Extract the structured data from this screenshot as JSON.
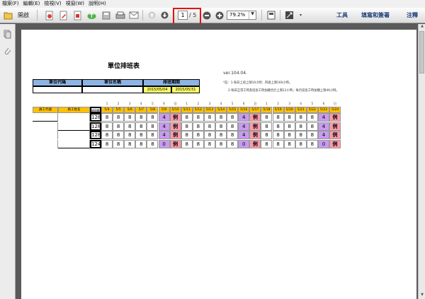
{
  "menu": [
    "檔案(F)",
    "編輯(E)",
    "檢視(V)",
    "視窗(W)",
    "說明(H)"
  ],
  "toolbar": {
    "open_label": "開啟",
    "page_current": "1",
    "page_total": "/ 5",
    "zoom": "79.2%",
    "tools_label": "工具",
    "fill_sign_label": "填寫和簽署",
    "comment_label": "注釋"
  },
  "document": {
    "title": "單位排班表",
    "version": "ver.104.04.",
    "note1": "*註：1.每日上班上限10小時；四週上限160小時。",
    "note2": "2.每日正常工時及延長工時加總合計上限12小時；每月延長工時加總上限46小時。",
    "header_table": {
      "unit_code_label": "單位代碼",
      "unit_name_label": "單位名稱",
      "period_label": "排班期間",
      "period_start": "2015/05/04",
      "period_end": "2015/05/31"
    },
    "schedule": {
      "emp_id_label": "員工代號",
      "emp_name_label": "員工姓名",
      "total_label": "總時數",
      "weekdays": [
        "1",
        "2",
        "3",
        "4",
        "5",
        "6",
        "日",
        "1",
        "2",
        "3",
        "4",
        "5",
        "6",
        "日",
        "1",
        "2",
        "3",
        "4",
        "5",
        "6",
        "日"
      ],
      "dates": [
        "5/4",
        "5/5",
        "5/6",
        "5/7",
        "5/8",
        "5/9",
        "5/10",
        "5/11",
        "5/12",
        "5/13",
        "5/14",
        "5/15",
        "5/16",
        "5/17",
        "5/18",
        "5/19",
        "5/20",
        "5/21",
        "5/22",
        "5/23",
        "5/24"
      ],
      "rows": [
        {
          "total": "128",
          "cells": [
            "8",
            "8",
            "8",
            "8",
            "8",
            "4",
            "例",
            "8",
            "8",
            "8",
            "8",
            "8",
            "4",
            "例",
            "8",
            "8",
            "8",
            "8",
            "8",
            "4",
            "例"
          ]
        },
        {
          "total": "128",
          "cells": [
            "8",
            "8",
            "8",
            "8",
            "8",
            "4",
            "例",
            "8",
            "8",
            "8",
            "8",
            "8",
            "4",
            "例",
            "8",
            "8",
            "8",
            "8",
            "8",
            "4",
            "例"
          ]
        },
        {
          "total": "128",
          "cells": [
            "8",
            "8",
            "8",
            "8",
            "8",
            "4",
            "例",
            "8",
            "8",
            "8",
            "8",
            "8",
            "4",
            "例",
            "8",
            "8",
            "8",
            "8",
            "8",
            "4",
            "例"
          ]
        },
        {
          "total": "124",
          "cells": [
            "8",
            "8",
            "8",
            "8",
            "8",
            "0",
            "例",
            "8",
            "8",
            "8",
            "8",
            "8",
            "0",
            "例",
            "8",
            "8",
            "8",
            "8",
            "8",
            "0",
            "例"
          ]
        }
      ]
    }
  },
  "colors": {
    "header_blue": "#8eb4e3",
    "date_orange": "#ffc000",
    "saturday_purple": "#c79bf0",
    "sunday_red": "#ff9aa8",
    "highlight_red": "#e01414"
  }
}
